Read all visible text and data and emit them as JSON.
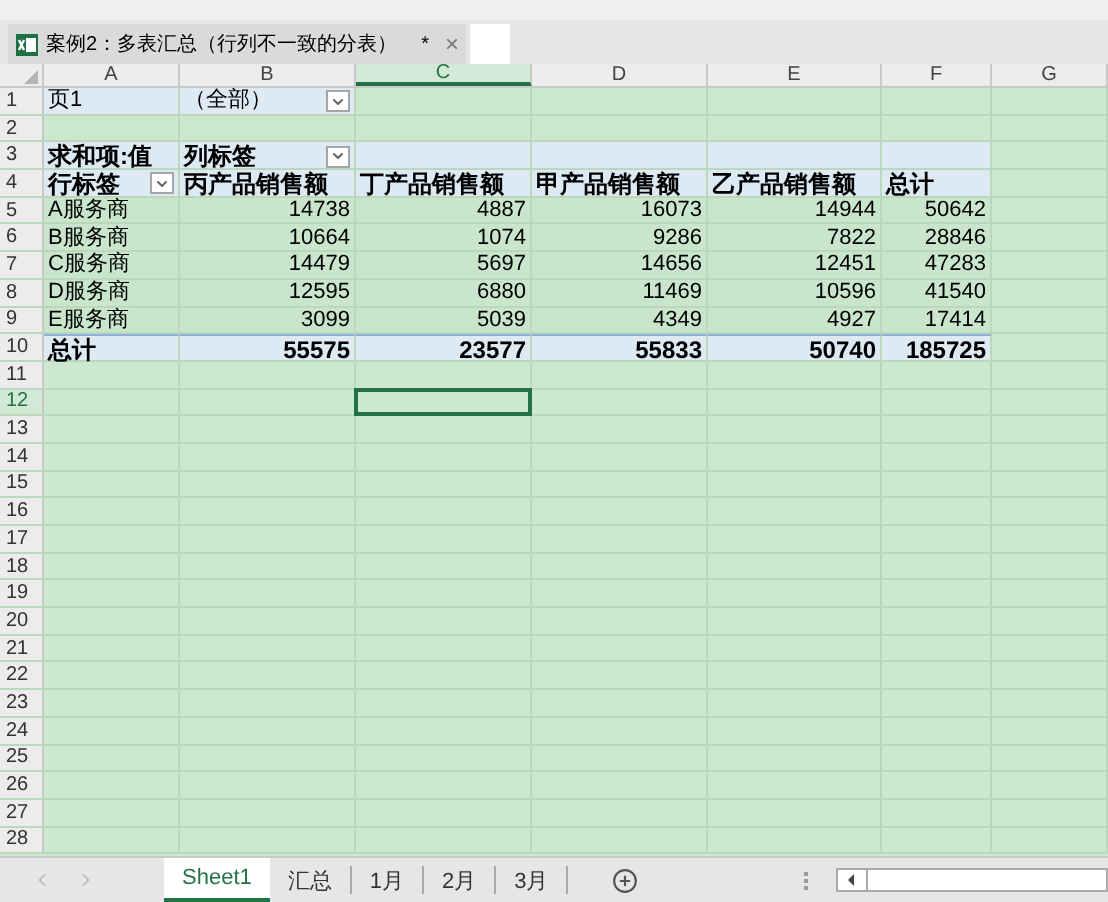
{
  "file_tab": {
    "title": "案例2：多表汇总（行列不一致的分表）",
    "modified_mark": "*",
    "close": "×"
  },
  "columns": [
    {
      "label": "A",
      "selected": false
    },
    {
      "label": "B",
      "selected": false
    },
    {
      "label": "C",
      "selected": true
    },
    {
      "label": "D",
      "selected": false
    },
    {
      "label": "E",
      "selected": false
    },
    {
      "label": "F",
      "selected": false
    },
    {
      "label": "G",
      "selected": false
    }
  ],
  "rows": [
    {
      "number": "1",
      "selected": false,
      "kind": "filter",
      "cells": [
        {
          "text": "页1",
          "dropdown": false
        },
        {
          "text": "（全部）",
          "dropdown": true
        }
      ]
    },
    {
      "number": "2",
      "selected": false,
      "kind": "blank"
    },
    {
      "number": "3",
      "selected": false,
      "kind": "header",
      "cells": [
        {
          "text": "求和项:值",
          "dropdown": false
        },
        {
          "text": "列标签",
          "dropdown": true
        }
      ]
    },
    {
      "number": "4",
      "selected": false,
      "kind": "header",
      "cells": [
        {
          "text": "行标签",
          "dropdown": true
        },
        {
          "text": "丙产品销售额",
          "dropdown": false
        },
        {
          "text": "丁产品销售额",
          "dropdown": false
        },
        {
          "text": "甲产品销售额",
          "dropdown": false
        },
        {
          "text": "乙产品销售额",
          "dropdown": false
        },
        {
          "text": "总计",
          "dropdown": false
        }
      ]
    },
    {
      "number": "5",
      "selected": false,
      "kind": "data",
      "cells": [
        {
          "text": "A服务商",
          "dropdown": false
        },
        {
          "text": "14738",
          "dropdown": false
        },
        {
          "text": "4887",
          "dropdown": false
        },
        {
          "text": "16073",
          "dropdown": false
        },
        {
          "text": "14944",
          "dropdown": false
        },
        {
          "text": "50642",
          "dropdown": false
        }
      ]
    },
    {
      "number": "6",
      "selected": false,
      "kind": "data",
      "cells": [
        {
          "text": "B服务商",
          "dropdown": false
        },
        {
          "text": "10664",
          "dropdown": false
        },
        {
          "text": "1074",
          "dropdown": false
        },
        {
          "text": "9286",
          "dropdown": false
        },
        {
          "text": "7822",
          "dropdown": false
        },
        {
          "text": "28846",
          "dropdown": false
        }
      ]
    },
    {
      "number": "7",
      "selected": false,
      "kind": "data",
      "cells": [
        {
          "text": "C服务商",
          "dropdown": false
        },
        {
          "text": "14479",
          "dropdown": false
        },
        {
          "text": "5697",
          "dropdown": false
        },
        {
          "text": "14656",
          "dropdown": false
        },
        {
          "text": "12451",
          "dropdown": false
        },
        {
          "text": "47283",
          "dropdown": false
        }
      ]
    },
    {
      "number": "8",
      "selected": false,
      "kind": "data",
      "cells": [
        {
          "text": "D服务商",
          "dropdown": false
        },
        {
          "text": "12595",
          "dropdown": false
        },
        {
          "text": "6880",
          "dropdown": false
        },
        {
          "text": "11469",
          "dropdown": false
        },
        {
          "text": "10596",
          "dropdown": false
        },
        {
          "text": "41540",
          "dropdown": false
        }
      ]
    },
    {
      "number": "9",
      "selected": false,
      "kind": "data",
      "cells": [
        {
          "text": "E服务商",
          "dropdown": false
        },
        {
          "text": "3099",
          "dropdown": false
        },
        {
          "text": "5039",
          "dropdown": false
        },
        {
          "text": "4349",
          "dropdown": false
        },
        {
          "text": "4927",
          "dropdown": false
        },
        {
          "text": "17414",
          "dropdown": false
        }
      ]
    },
    {
      "number": "10",
      "selected": false,
      "kind": "total",
      "cells": [
        {
          "text": "总计",
          "dropdown": false
        },
        {
          "text": "55575",
          "dropdown": false
        },
        {
          "text": "23577",
          "dropdown": false
        },
        {
          "text": "55833",
          "dropdown": false
        },
        {
          "text": "50740",
          "dropdown": false
        },
        {
          "text": "185725",
          "dropdown": false
        }
      ]
    },
    {
      "number": "11",
      "selected": false,
      "kind": "blank"
    },
    {
      "number": "12",
      "selected": true,
      "kind": "blank"
    },
    {
      "number": "13",
      "selected": false,
      "kind": "blank"
    },
    {
      "number": "14",
      "selected": false,
      "kind": "blank"
    },
    {
      "number": "15",
      "selected": false,
      "kind": "blank"
    },
    {
      "number": "16",
      "selected": false,
      "kind": "blank"
    },
    {
      "number": "17",
      "selected": false,
      "kind": "blank"
    },
    {
      "number": "18",
      "selected": false,
      "kind": "blank"
    },
    {
      "number": "19",
      "selected": false,
      "kind": "blank"
    },
    {
      "number": "20",
      "selected": false,
      "kind": "blank"
    },
    {
      "number": "21",
      "selected": false,
      "kind": "blank"
    },
    {
      "number": "22",
      "selected": false,
      "kind": "blank"
    },
    {
      "number": "23",
      "selected": false,
      "kind": "blank"
    },
    {
      "number": "24",
      "selected": false,
      "kind": "blank"
    },
    {
      "number": "25",
      "selected": false,
      "kind": "blank"
    },
    {
      "number": "26",
      "selected": false,
      "kind": "blank"
    },
    {
      "number": "27",
      "selected": false,
      "kind": "blank"
    },
    {
      "number": "28",
      "selected": false,
      "kind": "blank"
    }
  ],
  "sheet_tabs": [
    {
      "label": "Sheet1",
      "selected": true
    },
    {
      "label": "汇总",
      "selected": false
    },
    {
      "label": "1月",
      "selected": false
    },
    {
      "label": "2月",
      "selected": false
    },
    {
      "label": "3月",
      "selected": false
    }
  ]
}
